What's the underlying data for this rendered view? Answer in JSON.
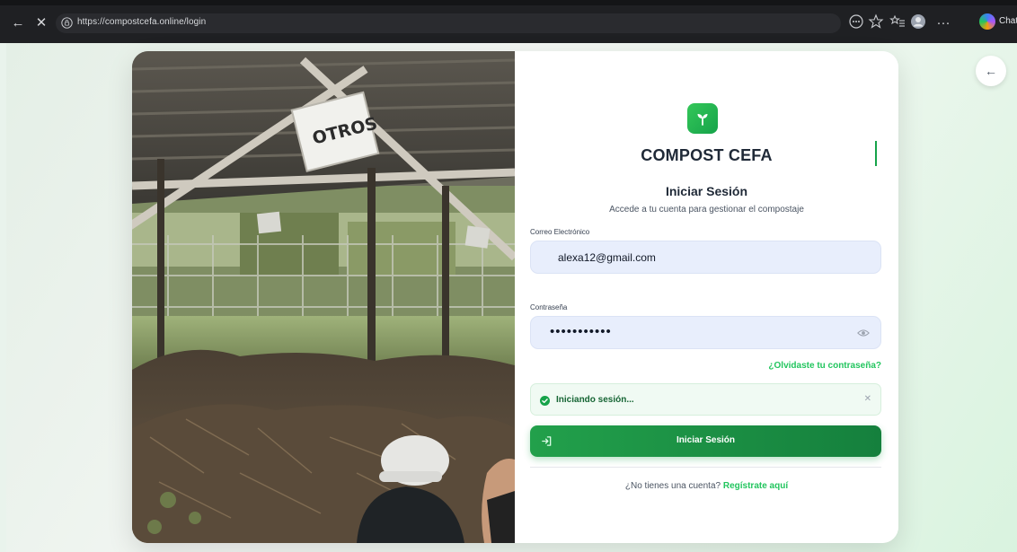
{
  "browser": {
    "url": "https://compostcefa.online/login",
    "chat_label": "Chat"
  },
  "brand": {
    "name": "COMPOST CEFA",
    "accent": "#22c55e"
  },
  "photo": {
    "sign_text": "OTROS"
  },
  "login": {
    "title": "Iniciar Sesión",
    "subtitle": "Accede a tu cuenta para gestionar el compostaje",
    "email_label": "Correo Electrónico",
    "email_value": "alexa12@gmail.com",
    "password_label": "Contraseña",
    "password_value": "•••••••••••",
    "forgot_link": "¿Olvidaste tu contraseña?",
    "status_message": "Iniciando sesión...",
    "submit_label": "Iniciar Sesión",
    "register_prompt": "¿No tienes una cuenta?",
    "register_link": "Regístrate aquí"
  },
  "icons": {
    "back": "arrow-left-icon",
    "close": "close-icon",
    "lock": "lock-icon",
    "eye": "eye-icon",
    "success": "check-circle-icon",
    "login": "sign-in-icon",
    "logo": "sprout-icon"
  }
}
